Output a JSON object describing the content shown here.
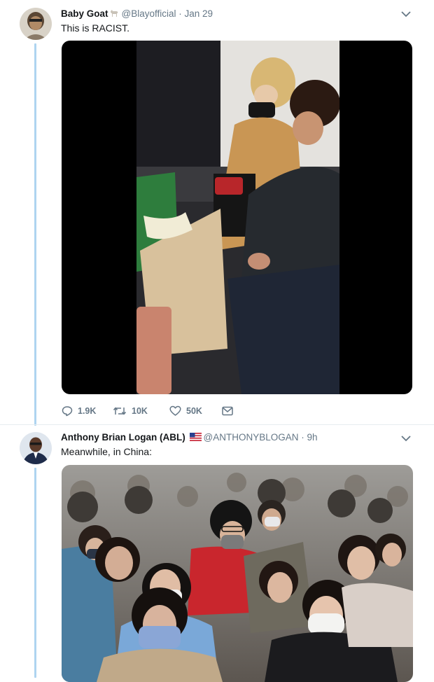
{
  "tweet1": {
    "name": "Baby Goat",
    "handle": "@Blayofficial",
    "time": "Jan 29",
    "text": "This is RACIST.",
    "replies": "1.9K",
    "retweets": "10K",
    "likes": "50K"
  },
  "tweet2": {
    "name": "Anthony Brian Logan (ABL)",
    "handle": "@ANTHONYBLOGAN",
    "time": "9h",
    "text": "Meanwhile, in China:"
  },
  "icons": {
    "caret": "chevron-down-icon",
    "reply": "reply-icon",
    "retweet": "retweet-icon",
    "like": "heart-icon",
    "dm": "envelope-icon",
    "verified_flag": "us-flag-icon",
    "goat": "goat-emoji-icon"
  },
  "colors": {
    "thread_line": "#aed4f0",
    "text_primary": "#14171a",
    "text_secondary": "#657786"
  }
}
